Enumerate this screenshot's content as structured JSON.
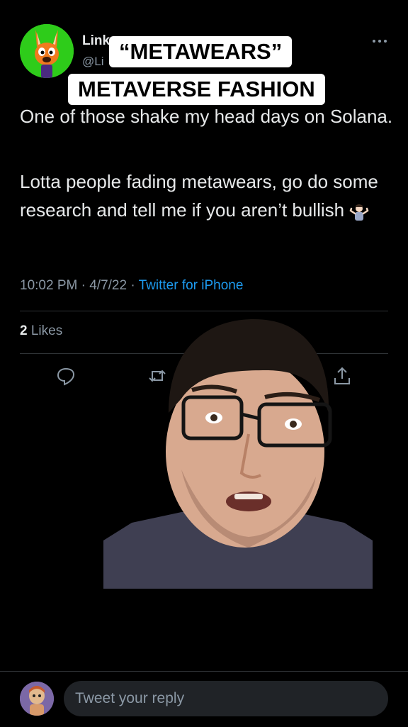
{
  "tweet": {
    "author_name": "Link",
    "author_handle": "@Li",
    "text_line_1": "One of those shake my head days on Solana.",
    "text_line_2": "Lotta people fading metawears, go do some research and tell me if you aren’t bullish",
    "time": "10:02 PM",
    "date": "4/7/22",
    "source": "Twitter for iPhone",
    "likes_count": "2",
    "likes_label": "Likes"
  },
  "caption": {
    "line1": "“METAWEARS”",
    "line2": "METAVERSE FASHION"
  },
  "reply": {
    "placeholder": "Tweet your reply"
  },
  "icons": {
    "more": "more-dots-icon",
    "reply": "reply-icon",
    "retweet": "retweet-icon",
    "share": "share-icon",
    "shrug": "person-shrugging-emoji"
  },
  "colors": {
    "background": "#000000",
    "text": "#e7e9ea",
    "muted": "#8b98a5",
    "link": "#1d9bf0",
    "divider": "#2f3336",
    "avatar_bg": "#2ecc1a"
  }
}
